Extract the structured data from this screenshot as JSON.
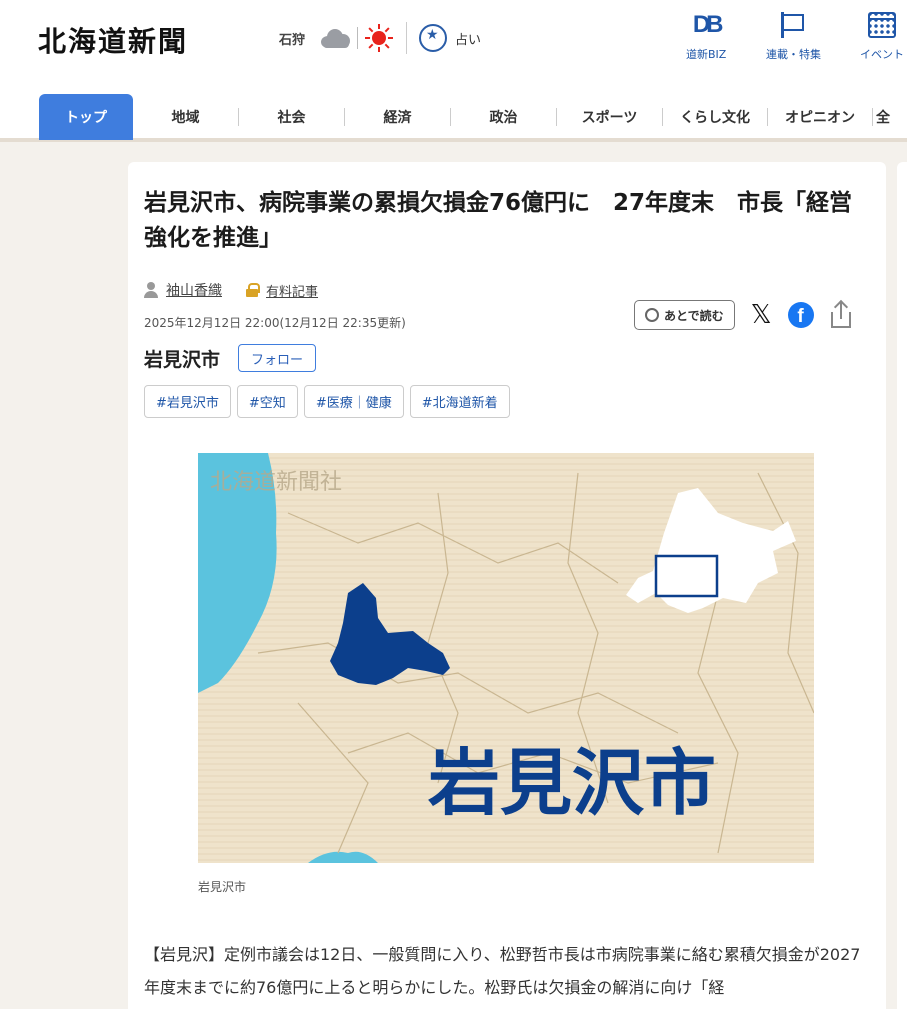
{
  "header": {
    "logo": "北海道新聞",
    "weather": {
      "city": "石狩",
      "icons": [
        "cloud-icon",
        "sun-icon"
      ]
    },
    "fortune_label": "占い",
    "links": [
      {
        "icon": "db-icon",
        "label": "道新BIZ"
      },
      {
        "icon": "flag-icon",
        "label": "連載・特集"
      },
      {
        "icon": "calendar-icon",
        "label": "イベント"
      }
    ]
  },
  "nav": {
    "items": [
      "トップ",
      "地域",
      "社会",
      "経済",
      "政治",
      "スポーツ",
      "くらし文化",
      "オピニオン",
      "全"
    ],
    "active_color": "#3f7dde"
  },
  "article": {
    "title": "岩見沢市、病院事業の累損欠損金76億円に　27年度末　市長「経営強化を推進」",
    "author": "袖山香織",
    "paid_label": "有料記事",
    "date": "2025年12月12日 22:00(12月12日 22:35更新)",
    "later_label": "あとで読む",
    "area": "岩見沢市",
    "follow_label": "フォロー",
    "tags": [
      "#岩見沢市",
      "#空知",
      "#医療｜健康",
      "#北海道新着"
    ],
    "figure": {
      "watermark": "北海道新聞社",
      "big_label": "岩見沢市",
      "highlight_color": "#0c3f8c"
    },
    "caption": "岩見沢市",
    "body": "【岩見沢】定例市議会は12日、一般質問に入り、松野哲市長は市病院事業に絡む累積欠損金が2027年度末までに約76億円に上ると明らかにした。松野氏は欠損金の解消に向け「経"
  }
}
